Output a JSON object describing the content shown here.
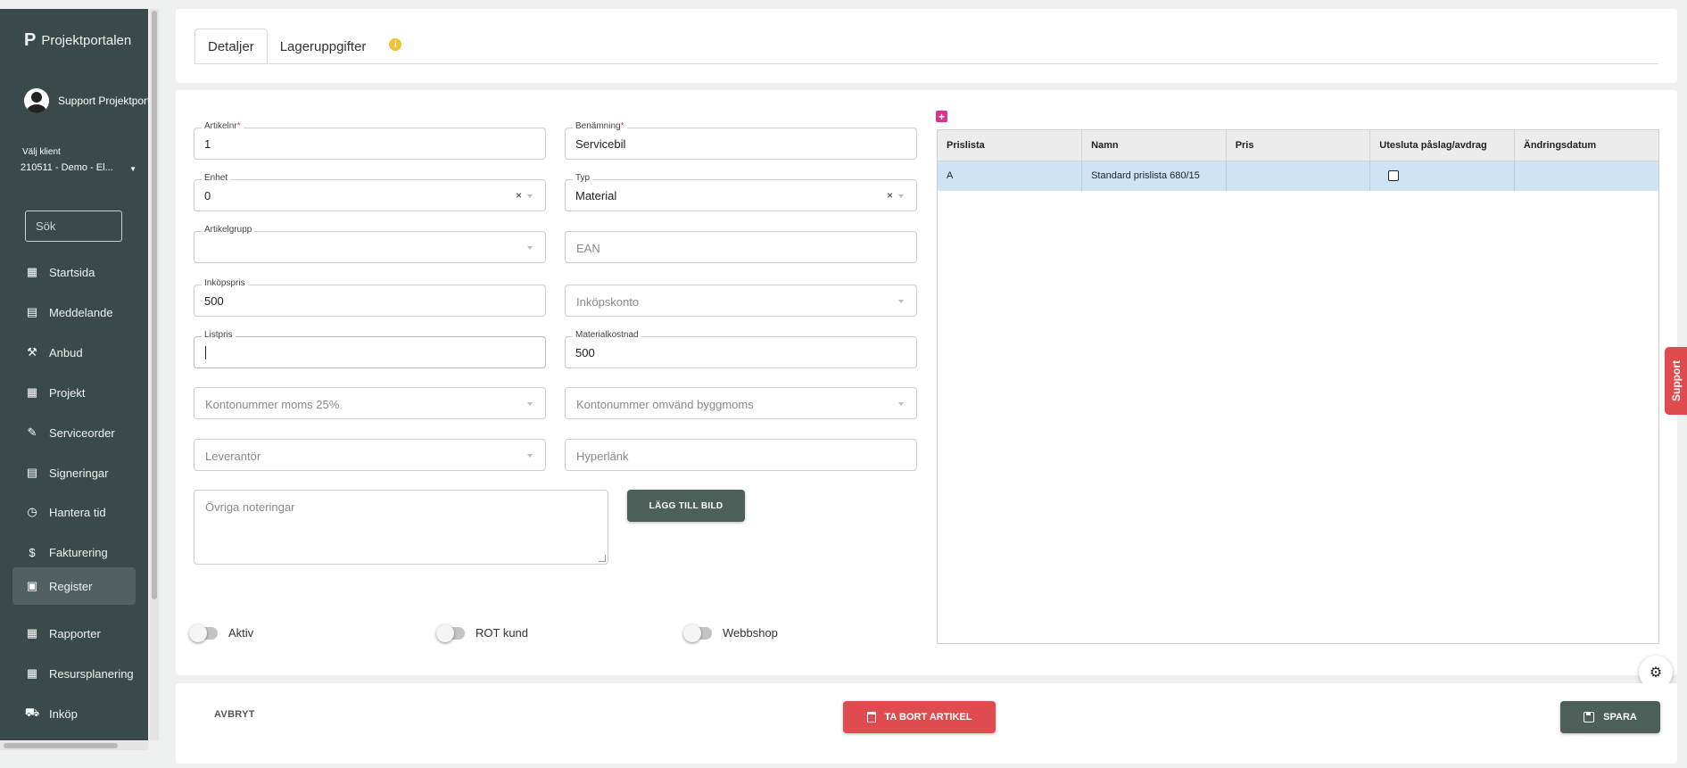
{
  "app": {
    "brand": "Projektportalen",
    "user_name": "Support Projektportalen",
    "client_label": "Välj klient",
    "client_value": "210511 - Demo - El...",
    "search_placeholder": "Sök"
  },
  "nav": [
    {
      "label": "Startsida",
      "icon": "dashboard-icon",
      "glyph": "▦"
    },
    {
      "label": "Meddelande",
      "icon": "message-icon",
      "glyph": "▤"
    },
    {
      "label": "Anbud",
      "icon": "gavel-icon",
      "glyph": "⚒"
    },
    {
      "label": "Projekt",
      "icon": "project-icon",
      "glyph": "▦"
    },
    {
      "label": "Serviceorder",
      "icon": "wrench-icon",
      "glyph": "✎"
    },
    {
      "label": "Signeringar",
      "icon": "signature-icon",
      "glyph": "▤"
    },
    {
      "label": "Hantera tid",
      "icon": "clock-icon",
      "glyph": "◷"
    },
    {
      "label": "Fakturering",
      "icon": "dollar-icon",
      "glyph": "$"
    },
    {
      "label": "Register",
      "icon": "register-icon",
      "glyph": "▣"
    },
    {
      "label": "Rapporter",
      "icon": "calendar-icon",
      "glyph": "▦"
    },
    {
      "label": "Resursplanering",
      "icon": "calendar-icon",
      "glyph": "▦"
    },
    {
      "label": "Inköp",
      "icon": "cart-icon",
      "glyph": "⛟"
    }
  ],
  "tabs": {
    "details": "Detaljer",
    "stock": "Lageruppgifter",
    "info_glyph": "i"
  },
  "form": {
    "article_no": {
      "label": "Artikelnr",
      "required": "*",
      "value": "1"
    },
    "name": {
      "label": "Benämning",
      "required": "*",
      "value": "Servicebil"
    },
    "unit": {
      "label": "Enhet",
      "value": "0"
    },
    "type": {
      "label": "Typ",
      "value": "Material"
    },
    "article_group": {
      "label": "Artikelgrupp",
      "value": ""
    },
    "ean": {
      "placeholder": "EAN"
    },
    "purchase_price": {
      "label": "Inköpspris",
      "value": "500"
    },
    "purchase_account": {
      "placeholder": "Inköpskonto"
    },
    "list_price": {
      "label": "Listpris",
      "value": ""
    },
    "material_cost": {
      "label": "Materialkostnad",
      "value": "500"
    },
    "vat_account": {
      "placeholder": "Kontonummer moms 25%"
    },
    "reverse_vat_account": {
      "placeholder": "Kontonummer omvänd byggmoms"
    },
    "supplier": {
      "placeholder": "Leverantör"
    },
    "hyperlink": {
      "placeholder": "Hyperlänk"
    },
    "notes": {
      "placeholder": "Övriga noteringar"
    },
    "add_image": "LÄGG TILL BILD",
    "clear_glyph": "×"
  },
  "toggles": {
    "active": "Aktiv",
    "rot": "ROT kund",
    "webshop": "Webbshop"
  },
  "price_grid": {
    "add_glyph": "+",
    "columns": [
      "Prislista",
      "Namn",
      "Pris",
      "Utesluta påslag/avdrag",
      "Ändringsdatum"
    ],
    "rows": [
      {
        "pricelist": "A",
        "name": "Standard prislista 680/15",
        "price": "",
        "exclude": false,
        "changed": ""
      }
    ]
  },
  "support_tab": "Support",
  "footer": {
    "cancel": "AVBRYT",
    "delete": "TA BORT ARTIKEL",
    "save": "SPARA"
  },
  "colors": {
    "sidebar": "#3a4a4a",
    "primary_dark": "#4d5f59",
    "danger": "#e04b4f",
    "accent_pink": "#d8358f",
    "row_selected": "#cfe3f7"
  }
}
